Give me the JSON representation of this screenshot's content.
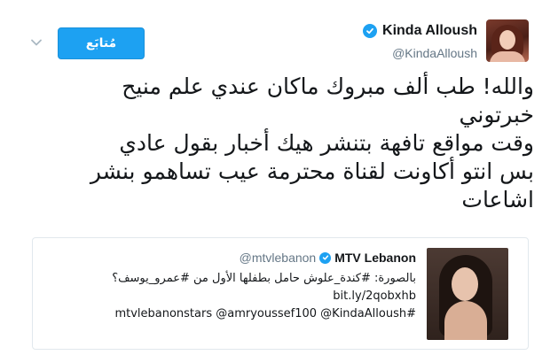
{
  "header": {
    "display_name": "Kinda Alloush",
    "handle": "@KindaAlloush",
    "follow_label": "مُتابَع",
    "icons": {
      "verified": "verified-badge-icon",
      "more": "chevron-down-icon"
    }
  },
  "tweet": {
    "lines": [
      "والله! طب ألف مبروك ماكان عندي علم منيح",
      "خبرتوني",
      "وقت مواقع تافهة بتنشر هيك أخبار بقول عادي",
      "بس انتو أكاونت لقناة محترمة عيب تساهمو بنشر",
      "اشاعات"
    ]
  },
  "quote": {
    "display_name": "MTV Lebanon",
    "handle": "@mtvlebanon",
    "lines": [
      "بالصورة: #كندة_علوش حامل بطفلها الأول من #عمرو_يوسف؟",
      "bit.ly/2qobxhb",
      "#mtvlebanonstars @amryoussef100 @KindaAlloush"
    ]
  },
  "colors": {
    "accent": "#1da1f2",
    "text": "#14171a",
    "muted": "#657786",
    "border": "#e1e8ed"
  }
}
